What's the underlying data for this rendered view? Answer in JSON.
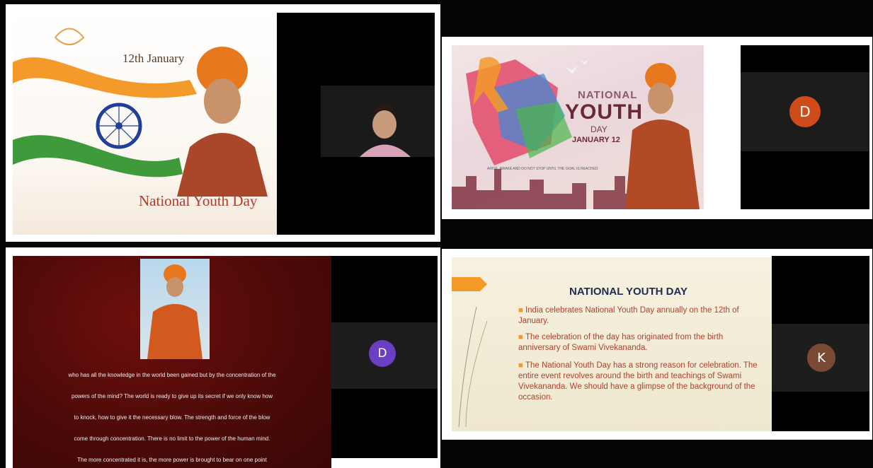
{
  "panel1": {
    "date": "12th January",
    "title": "National Youth Day"
  },
  "panel2": {
    "national": "NATIONAL",
    "youth": "YOUTH",
    "day": "DAY",
    "date": "JANUARY 12",
    "tagline": "ARISE, AWAKE AND DO NOT STOP UNTIL THE GOAL IS REACHED",
    "participant": {
      "initial": "D",
      "color": "#d04b1c"
    }
  },
  "panel3": {
    "lines": [
      "who has all the knowledge in the world been gained but by the concentration of the",
      "powers of the mind? The world is ready to give up its secret if we only know how",
      "to knock, how to give it the necessary blow. The strength and force of the blow",
      "come through concentration. There is no limit to the power of the human mind.",
      "The more concentrated it is, the more power is brought to bear on one point"
    ],
    "participant": {
      "initial": "D",
      "color": "#6a3fc4"
    }
  },
  "panel4": {
    "title": "NATIONAL YOUTH DAY",
    "bullets": [
      "India celebrates National Youth Day annually on the 12th of January.",
      "The celebration of the day has originated from the birth anniversary of Swami Vivekananda.",
      "The National Youth Day has a strong reason for celebration. The entire event revolves around the birth and teachings of Swami Vivekananda. We should have a glimpse of the background of the occasion."
    ],
    "participant": {
      "initial": "K",
      "color": "#7a4a35"
    }
  }
}
